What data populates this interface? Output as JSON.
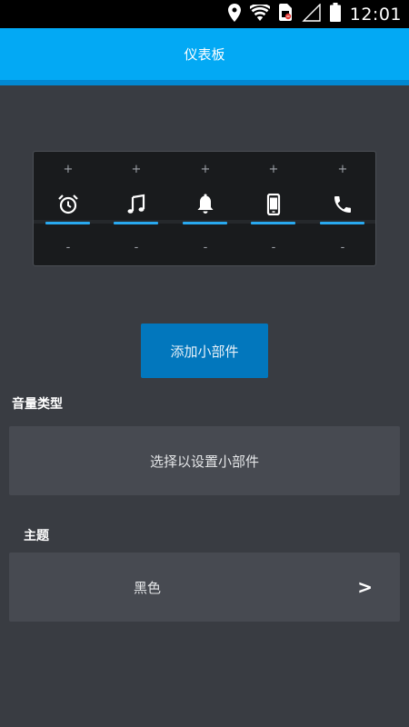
{
  "status_bar": {
    "time": "12:01",
    "icons": [
      "location-icon",
      "wifi-icon",
      "sim-icon",
      "signal-icon",
      "battery-icon"
    ]
  },
  "app_bar": {
    "title": "仪表板",
    "color": "#03a9f4"
  },
  "widget_preview": {
    "plus_symbol": "+",
    "minus_symbol": "-",
    "items": [
      {
        "icon": "alarm-icon"
      },
      {
        "icon": "music-note-icon"
      },
      {
        "icon": "bell-icon"
      },
      {
        "icon": "phone-device-icon"
      },
      {
        "icon": "phone-call-icon"
      }
    ],
    "accent_color": "#29a9f0"
  },
  "add_widget_button": {
    "label": "添加小部件",
    "color": "#0277bd"
  },
  "volume_type": {
    "label": "音量类型",
    "selector_text": "选择以设置小部件"
  },
  "theme": {
    "label": "主题",
    "value": "黑色",
    "chevron": ">"
  }
}
